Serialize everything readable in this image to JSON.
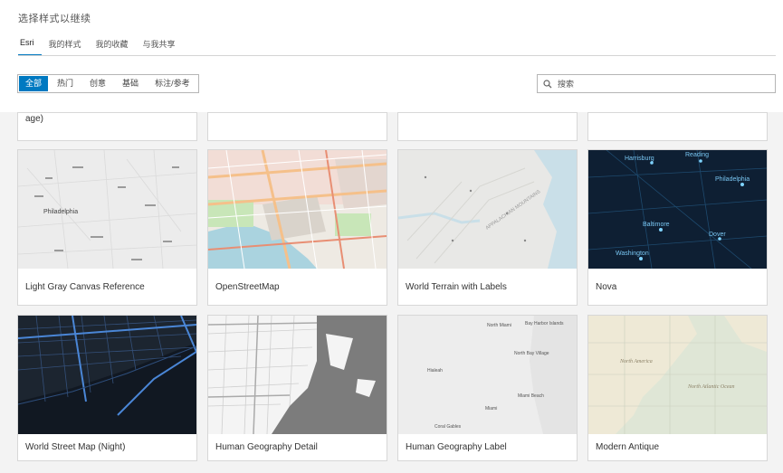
{
  "dialog": {
    "title": "选择样式以继续"
  },
  "tabs": [
    {
      "label": "Esri",
      "active": true
    },
    {
      "label": "我的样式",
      "active": false
    },
    {
      "label": "我的收藏",
      "active": false
    },
    {
      "label": "与我共享",
      "active": false
    }
  ],
  "filters": [
    {
      "label": "全部",
      "active": true
    },
    {
      "label": "热门",
      "active": false
    },
    {
      "label": "创意",
      "active": false
    },
    {
      "label": "基础",
      "active": false
    },
    {
      "label": "标注/参考",
      "active": false
    }
  ],
  "search": {
    "placeholder": "搜索",
    "value": ""
  },
  "partial_row": [
    {
      "label": "age)"
    },
    {
      "label": ""
    },
    {
      "label": ""
    },
    {
      "label": ""
    }
  ],
  "gallery": [
    {
      "label": "Light Gray Canvas Reference",
      "thumb_text": [
        "Philadelphia"
      ]
    },
    {
      "label": "OpenStreetMap",
      "thumb_text": []
    },
    {
      "label": "World Terrain with Labels",
      "thumb_text": [
        "APPALACHIAN MOUNTAINS"
      ]
    },
    {
      "label": "Nova",
      "thumb_text": [
        "Harrisburg",
        "Reading",
        "Philadelphia",
        "Baltimore",
        "Dover",
        "Washington"
      ]
    },
    {
      "label": "World Street Map (Night)",
      "thumb_text": []
    },
    {
      "label": "Human Geography Detail",
      "thumb_text": []
    },
    {
      "label": "Human Geography Label",
      "thumb_text": [
        "North Miami",
        "Bay Harbor Islands",
        "North Bay Village",
        "Hialeah",
        "Miami Beach",
        "Miami",
        "Coral Gables"
      ]
    },
    {
      "label": "Modern Antique",
      "thumb_text": [
        "North America",
        "North Atlantic Ocean"
      ]
    }
  ],
  "colors": {
    "accent": "#0079c1",
    "nova_bg": "#0e1f33",
    "night_bg": "#1c2530",
    "antique_bg": "#dfe6d6"
  }
}
